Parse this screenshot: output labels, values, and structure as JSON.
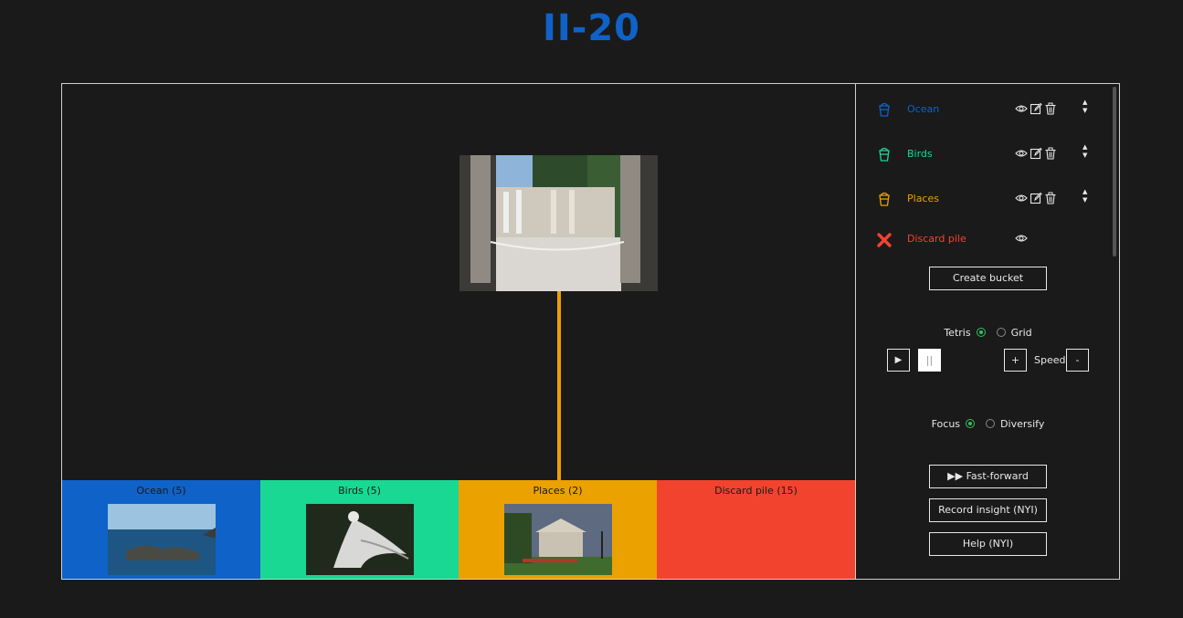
{
  "app": {
    "logo": "II-20"
  },
  "colors": {
    "ocean": "#0f62c8",
    "birds": "#19d894",
    "places": "#eba100",
    "discard": "#f2432f",
    "logo": "#0f62c8",
    "radio_on": "#2fc25b"
  },
  "stage": {
    "current_image": "image-ruins-columns",
    "buckets": [
      {
        "name": "Ocean",
        "count": "(5)",
        "thumb": "image-ocean-rocks"
      },
      {
        "name": "Birds",
        "count": "(5)",
        "thumb": "image-vulture-wings"
      },
      {
        "name": "Places",
        "count": "(2)",
        "thumb": "image-classical-building"
      },
      {
        "name": "Discard pile",
        "count": "(15)",
        "thumb": ""
      }
    ]
  },
  "sidebar": {
    "buckets": [
      {
        "name": "Ocean",
        "icon": "bucket-icon"
      },
      {
        "name": "Birds",
        "icon": "bucket-icon"
      },
      {
        "name": "Places",
        "icon": "bucket-icon"
      }
    ],
    "discard": {
      "name": "Discard pile",
      "icon": "x-icon"
    },
    "create_bucket": "Create bucket",
    "mode": {
      "option1": "Tetris",
      "option2": "Grid",
      "selected": "Tetris"
    },
    "play": "▶",
    "pause": "||",
    "speed_label": "Speed",
    "speed_plus": "+",
    "speed_minus": "-",
    "strategy": {
      "option1": "Focus",
      "option2": "Diversify",
      "selected": "Focus"
    },
    "fast_forward": "▶▶ Fast-forward",
    "record_insight": "Record insight (NYI)",
    "help": "Help (NYI)"
  }
}
